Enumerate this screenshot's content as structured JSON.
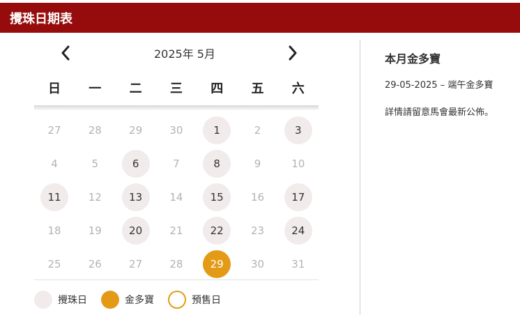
{
  "header": {
    "title": "攪珠日期表"
  },
  "calendar": {
    "month_label": "2025年 5月",
    "weekdays": [
      "日",
      "一",
      "二",
      "三",
      "四",
      "五",
      "六"
    ],
    "weeks": [
      [
        {
          "n": "27",
          "t": "out"
        },
        {
          "n": "28",
          "t": "out"
        },
        {
          "n": "29",
          "t": "out"
        },
        {
          "n": "30",
          "t": "out"
        },
        {
          "n": "1",
          "t": "race"
        },
        {
          "n": "2",
          "t": "none"
        },
        {
          "n": "3",
          "t": "race"
        }
      ],
      [
        {
          "n": "4",
          "t": "none"
        },
        {
          "n": "5",
          "t": "none"
        },
        {
          "n": "6",
          "t": "race"
        },
        {
          "n": "7",
          "t": "none"
        },
        {
          "n": "8",
          "t": "race"
        },
        {
          "n": "9",
          "t": "none"
        },
        {
          "n": "10",
          "t": "none"
        }
      ],
      [
        {
          "n": "11",
          "t": "race"
        },
        {
          "n": "12",
          "t": "none"
        },
        {
          "n": "13",
          "t": "race"
        },
        {
          "n": "14",
          "t": "none"
        },
        {
          "n": "15",
          "t": "race"
        },
        {
          "n": "16",
          "t": "none"
        },
        {
          "n": "17",
          "t": "race"
        }
      ],
      [
        {
          "n": "18",
          "t": "none"
        },
        {
          "n": "19",
          "t": "none"
        },
        {
          "n": "20",
          "t": "race"
        },
        {
          "n": "21",
          "t": "none"
        },
        {
          "n": "22",
          "t": "race"
        },
        {
          "n": "23",
          "t": "none"
        },
        {
          "n": "24",
          "t": "race"
        }
      ],
      [
        {
          "n": "25",
          "t": "none"
        },
        {
          "n": "26",
          "t": "none"
        },
        {
          "n": "27",
          "t": "none"
        },
        {
          "n": "28",
          "t": "none"
        },
        {
          "n": "29",
          "t": "gold"
        },
        {
          "n": "30",
          "t": "none"
        },
        {
          "n": "31",
          "t": "none"
        }
      ]
    ]
  },
  "legend": {
    "race_label": "攪珠日",
    "gold_label": "金多寶",
    "presale_label": "預售日"
  },
  "info": {
    "title": "本月金多寶",
    "entry": "29-05-2025 – 端午金多寶",
    "note": "詳情請留意馬會最新公佈。"
  },
  "colors": {
    "header_bg": "#960c0c",
    "race_day": "#f1ebeb",
    "gold_day": "#e39b17",
    "muted_text": "#b3b3b3"
  },
  "icons": {
    "prev": "chevron-left-icon",
    "next": "chevron-right-icon"
  }
}
